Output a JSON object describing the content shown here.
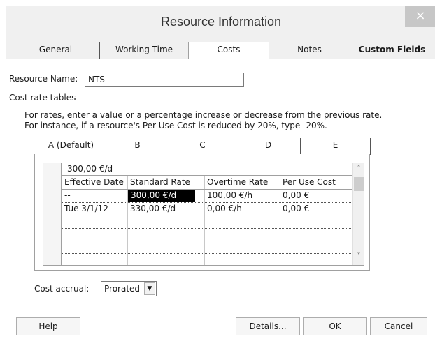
{
  "window": {
    "title": "Resource Information",
    "close_label": "×"
  },
  "tabs": [
    {
      "label": "General"
    },
    {
      "label": "Working Time"
    },
    {
      "label": "Costs"
    },
    {
      "label": "Notes"
    },
    {
      "label": "Custom Fields"
    }
  ],
  "resource_name": {
    "label": "Resource Name:",
    "value": "NTS"
  },
  "cost_rate_tables": {
    "group_label": "Cost rate tables",
    "help_line_1": "For rates, enter a value or a percentage increase or decrease from the previous rate.",
    "help_line_2": "For instance, if a resource's Per Use Cost is reduced by 20%, type -20%.",
    "tabs": [
      {
        "label": "A (Default)"
      },
      {
        "label": "B"
      },
      {
        "label": "C"
      },
      {
        "label": "D"
      },
      {
        "label": "E"
      }
    ],
    "edit_value": "300,00 €/d",
    "columns": [
      "Effective Date",
      "Standard Rate",
      "Overtime Rate",
      "Per Use Cost"
    ],
    "rows": [
      {
        "effective_date": "--",
        "standard_rate": "300,00 €/d",
        "overtime_rate": "100,00 €/h",
        "per_use_cost": "0,00 €"
      },
      {
        "effective_date": "Tue 3/1/12",
        "standard_rate": "330,00 €/d",
        "overtime_rate": "0,00 €/h",
        "per_use_cost": "0,00 €"
      }
    ]
  },
  "cost_accrual": {
    "label": "Cost accrual:",
    "value": "Prorated"
  },
  "buttons": {
    "help": "Help",
    "details": "Details...",
    "ok": "OK",
    "cancel": "Cancel"
  }
}
